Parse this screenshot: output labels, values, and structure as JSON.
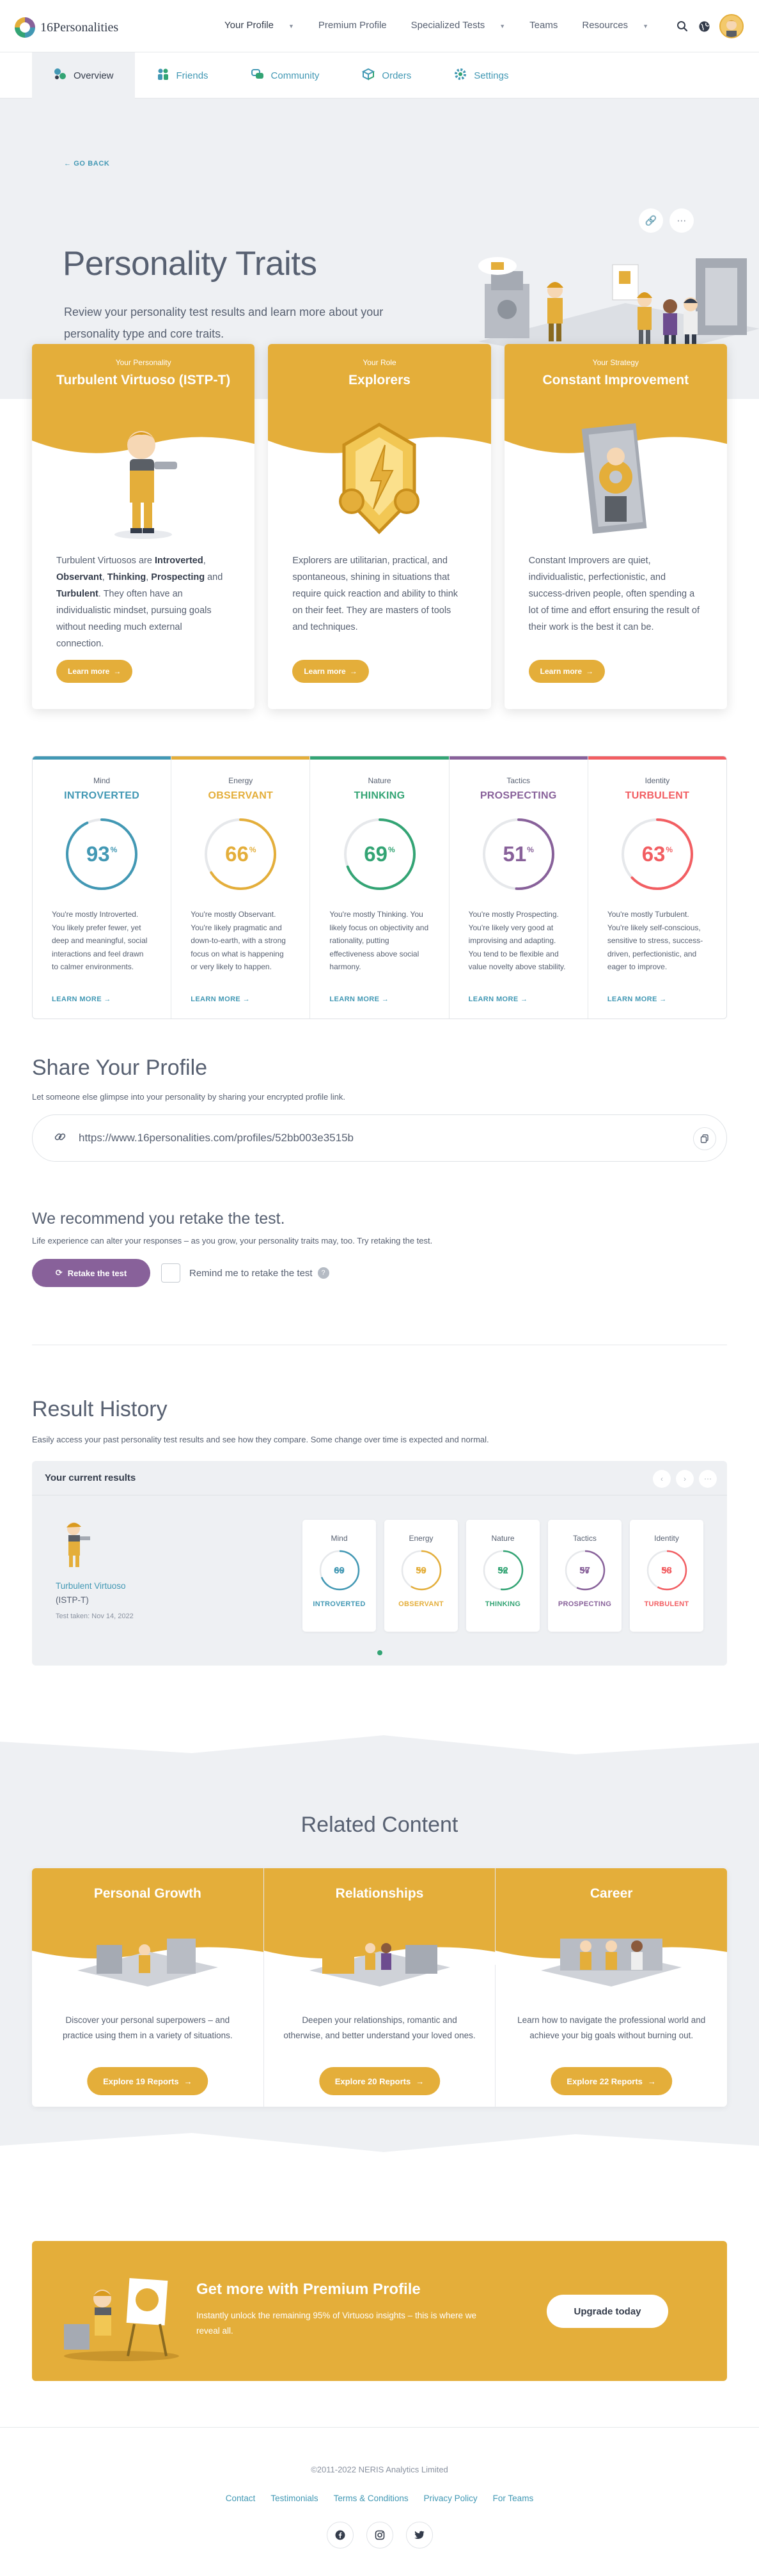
{
  "header": {
    "logo_text": "16Personalities",
    "nav": [
      {
        "label": "Your Profile",
        "has_caret": true
      },
      {
        "label": "Premium Profile",
        "has_caret": false
      },
      {
        "label": "Specialized Tests",
        "has_caret": true
      },
      {
        "label": "Teams",
        "has_caret": false
      },
      {
        "label": "Resources",
        "has_caret": true
      }
    ],
    "icons": [
      "search-icon",
      "globe-icon",
      "avatar"
    ]
  },
  "subnav": [
    {
      "label": "Overview",
      "icon": "overview-icon",
      "active": true
    },
    {
      "label": "Friends",
      "icon": "friends-icon",
      "active": false
    },
    {
      "label": "Community",
      "icon": "community-icon",
      "active": false
    },
    {
      "label": "Orders",
      "icon": "orders-icon",
      "active": false
    },
    {
      "label": "Settings",
      "icon": "settings-icon",
      "active": false
    }
  ],
  "hero": {
    "go_back": "GO BACK",
    "title": "Personality Traits",
    "description": "Review your personality test results and learn more about your personality type and core traits."
  },
  "cards": [
    {
      "kicker": "Your Personality",
      "title": "Turbulent Virtuoso (ISTP-T)",
      "text_html": "Turbulent Virtuosos are <b>Introverted</b>, <b>Observant</b>, <b>Thinking</b>, <b>Prospecting</b> and <b>Turbulent</b>. They often have an individualistic mindset, pursuing goals without needing much external connection.",
      "button": "Learn more"
    },
    {
      "kicker": "Your Role",
      "title": "Explorers",
      "text_html": "Explorers are utilitarian, practical, and spontaneous, shining in situations that require quick reaction and ability to think on their feet. They are masters of tools and techniques.",
      "button": "Learn more"
    },
    {
      "kicker": "Your Strategy",
      "title": "Constant Improvement",
      "text_html": "Constant Improvers are quiet, individualistic, perfectionistic, and success-driven people, often spending a lot of time and effort ensuring the result of their work is the best it can be.",
      "button": "Learn more"
    }
  ],
  "traits": [
    {
      "label": "Mind",
      "name": "INTROVERTED",
      "percent": 93,
      "color": "#4298b4",
      "desc": "You're mostly Introverted. You likely prefer fewer, yet deep and meaningful, social interactions and feel drawn to calmer environments.",
      "link": "LEARN MORE"
    },
    {
      "label": "Energy",
      "name": "OBSERVANT",
      "percent": 66,
      "color": "#e4ae3a",
      "desc": "You're mostly Observant. You're likely pragmatic and down-to-earth, with a strong focus on what is happening or very likely to happen.",
      "link": "LEARN MORE"
    },
    {
      "label": "Nature",
      "name": "THINKING",
      "percent": 69,
      "color": "#33a474",
      "desc": "You're mostly Thinking. You likely focus on objectivity and rationality, putting effectiveness above social harmony.",
      "link": "LEARN MORE"
    },
    {
      "label": "Tactics",
      "name": "PROSPECTING",
      "percent": 51,
      "color": "#88619a",
      "desc": "You're mostly Prospecting. You're likely very good at improvising and adapting. You tend to be flexible and value novelty above stability.",
      "link": "LEARN MORE"
    },
    {
      "label": "Identity",
      "name": "TURBULENT",
      "percent": 63,
      "color": "#f25e62",
      "desc": "You're mostly Turbulent. You're likely self-conscious, sensitive to stress, success-driven, perfectionistic, and eager to improve.",
      "link": "LEARN MORE"
    }
  ],
  "share": {
    "title": "Share Your Profile",
    "subtitle": "Let someone else glimpse into your personality by sharing your encrypted profile link.",
    "url": "https://www.16personalities.com/profiles/52bb003e3515b"
  },
  "retake": {
    "title": "We recommend you retake the test.",
    "subtitle": "Life experience can alter your responses – as you grow, your personality traits may, too. Try retaking the test.",
    "button": "Retake the test",
    "reminder": "Remind me to retake the test",
    "help": "?"
  },
  "history": {
    "title": "Result History",
    "subtitle": "Easily access your past personality test results and see how they compare. Some change over time is expected and normal.",
    "box_title": "Your current results",
    "type_name": "Turbulent Virtuoso",
    "type_code": "(ISTP-T)",
    "date": "Test taken: Nov 14, 2022",
    "minis": [
      {
        "label": "Mind",
        "percent": 69,
        "name": "INTROVERTED",
        "color": "#4298b4"
      },
      {
        "label": "Energy",
        "percent": 59,
        "name": "OBSERVANT",
        "color": "#e4ae3a"
      },
      {
        "label": "Nature",
        "percent": 52,
        "name": "THINKING",
        "color": "#33a474"
      },
      {
        "label": "Tactics",
        "percent": 57,
        "name": "PROSPECTING",
        "color": "#88619a"
      },
      {
        "label": "Identity",
        "percent": 58,
        "name": "TURBULENT",
        "color": "#f25e62"
      }
    ]
  },
  "related": {
    "title": "Related Content",
    "cards": [
      {
        "title": "Personal Growth",
        "desc": "Discover your personal superpowers – and practice using them in a variety of situations.",
        "button": "Explore 19 Reports"
      },
      {
        "title": "Relationships",
        "desc": "Deepen your relationships, romantic and otherwise, and better understand your loved ones.",
        "button": "Explore 20 Reports"
      },
      {
        "title": "Career",
        "desc": "Learn how to navigate the professional world and achieve your big goals without burning out.",
        "button": "Explore 22 Reports"
      }
    ]
  },
  "premium": {
    "title": "Get more with Premium Profile",
    "desc": "Instantly unlock the remaining 95% of Virtuoso insights – this is where we reveal all.",
    "button": "Upgrade today"
  },
  "footer": {
    "copyright": "©2011-2022 NERIS Analytics Limited",
    "links": [
      "Contact",
      "Testimonials",
      "Terms & Conditions",
      "Privacy Policy",
      "For Teams"
    ],
    "social": [
      "facebook-icon",
      "instagram-icon",
      "twitter-icon"
    ]
  },
  "colors": {
    "gold": "#e4ae3a",
    "blue": "#4298b4",
    "green": "#33a474",
    "purple": "#88619a",
    "red": "#f25e62",
    "gray_bg": "#eef0f3"
  }
}
